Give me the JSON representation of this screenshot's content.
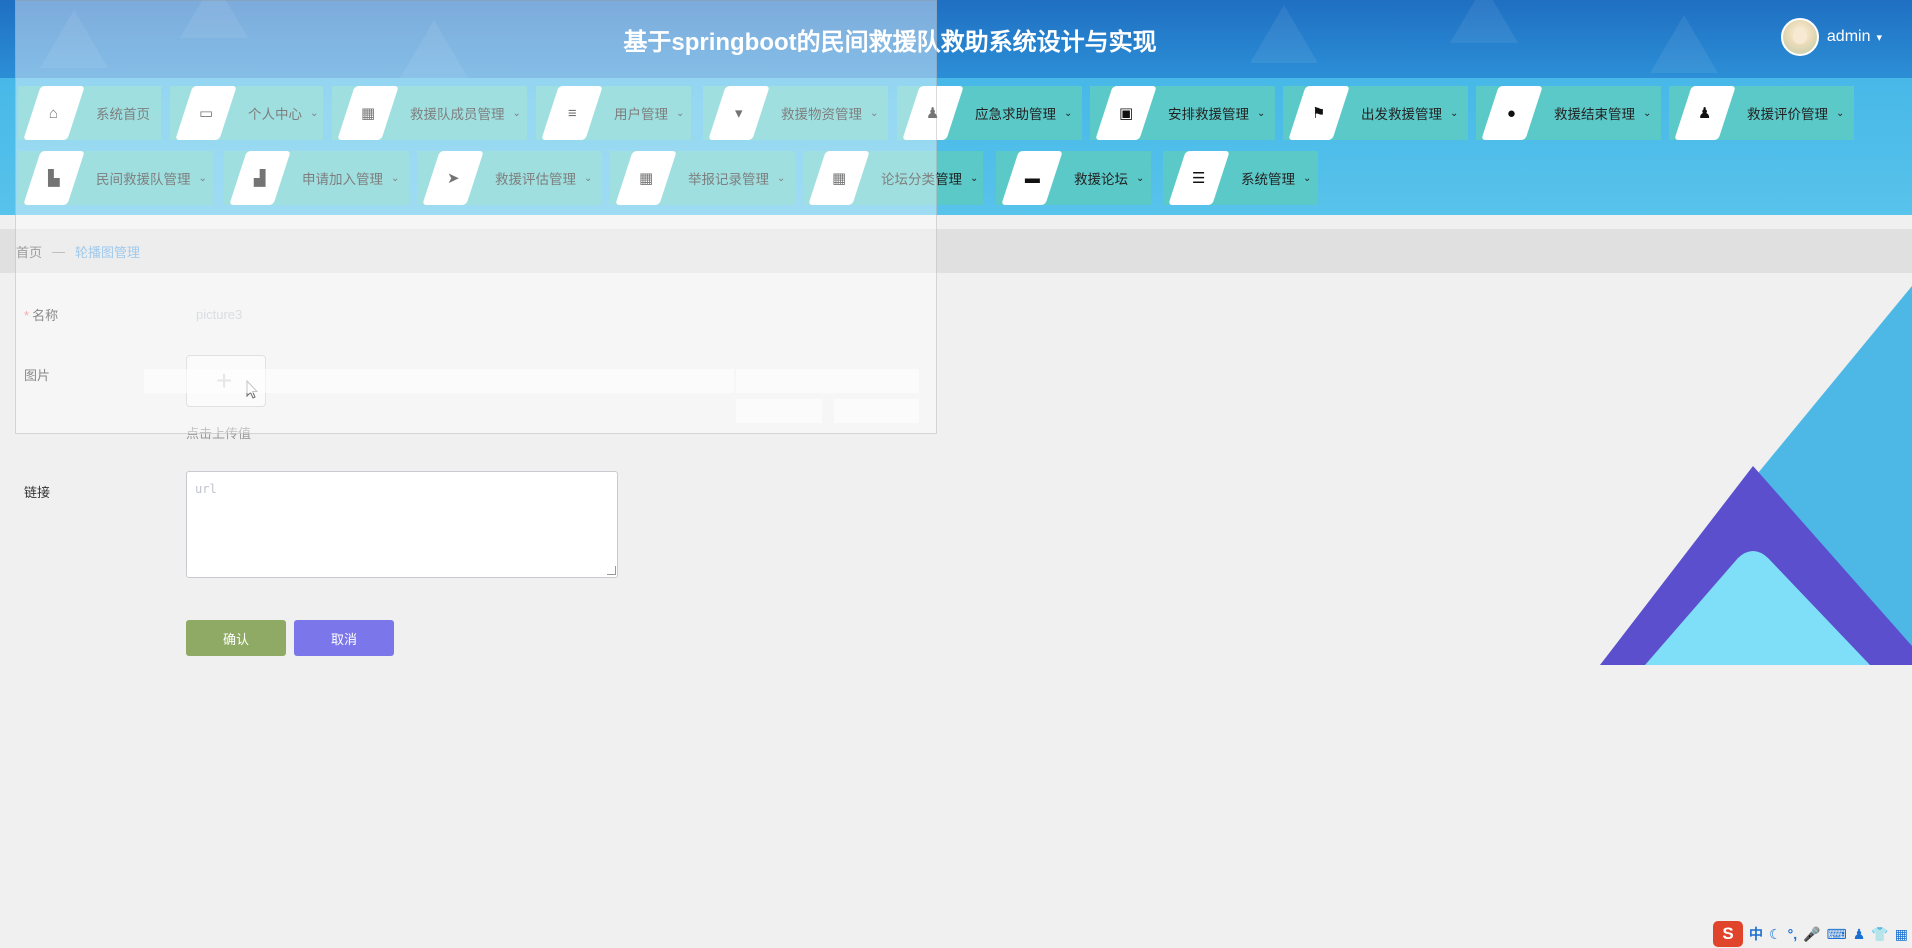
{
  "header": {
    "title": "基于springboot的民间救援队救助系统设计与实现",
    "user_name": "admin",
    "user_caret": "▾"
  },
  "nav": {
    "row1": [
      {
        "label": "系统首页",
        "icon": "home-icon",
        "glyph": "⌂",
        "has_submenu": false
      },
      {
        "label": "个人中心",
        "icon": "card-icon",
        "glyph": "▭",
        "has_submenu": true
      },
      {
        "label": "救援队成员管理",
        "icon": "grid-icon",
        "glyph": "▦",
        "has_submenu": true
      },
      {
        "label": "用户管理",
        "icon": "sliders-icon",
        "glyph": "≡",
        "has_submenu": true
      },
      {
        "label": "救援物资管理",
        "icon": "brush-icon",
        "glyph": "▾",
        "has_submenu": true
      },
      {
        "label": "应急求助管理",
        "icon": "person-icon",
        "glyph": "♟",
        "has_submenu": true
      },
      {
        "label": "安排救援管理",
        "icon": "clipboard-icon",
        "glyph": "▣",
        "has_submenu": true
      },
      {
        "label": "出发救援管理",
        "icon": "flag-icon",
        "glyph": "⚑",
        "has_submenu": true
      },
      {
        "label": "救援结束管理",
        "icon": "location-icon",
        "glyph": "●",
        "has_submenu": true
      },
      {
        "label": "救援评价管理",
        "icon": "user-icon",
        "glyph": "♟",
        "has_submenu": true
      }
    ],
    "row2": [
      {
        "label": "民间救援队管理",
        "icon": "building-icon",
        "glyph": "▙",
        "has_submenu": true
      },
      {
        "label": "申请加入管理",
        "icon": "mailbox-icon",
        "glyph": "▟",
        "has_submenu": true
      },
      {
        "label": "救援评估管理",
        "icon": "send-icon",
        "glyph": "➤",
        "has_submenu": true
      },
      {
        "label": "举报记录管理",
        "icon": "grid-icon",
        "glyph": "▦",
        "has_submenu": true
      },
      {
        "label": "论坛分类管理",
        "icon": "grid-icon",
        "glyph": "▦",
        "has_submenu": true
      },
      {
        "label": "救援论坛",
        "icon": "chat-icon",
        "glyph": "▬",
        "has_submenu": true
      },
      {
        "label": "系统管理",
        "icon": "menu-icon",
        "glyph": "☰",
        "has_submenu": true
      }
    ],
    "caret": "⌄"
  },
  "breadcrumb": {
    "home": "首页",
    "separator": "—",
    "current": "轮播图管理"
  },
  "form": {
    "name_label": "名称",
    "required_mark": "*",
    "name_placeholder": "picture3",
    "image_label": "图片",
    "upload_plus": "+",
    "upload_tip": "点击上传值",
    "link_label": "链接",
    "link_placeholder": "url",
    "confirm_label": "确认",
    "cancel_label": "取消"
  },
  "tray": {
    "logo": "S",
    "ime": "中",
    "items": [
      "☾",
      "°,",
      "🎤",
      "⌨",
      "♟",
      "👕",
      "▦"
    ]
  },
  "colors": {
    "header_bg": "#1f6fc2",
    "nav_bg": "#4fbde9",
    "nav_item_bg": "#5cc9c9",
    "confirm_bg": "#8faa64",
    "cancel_bg": "#7b77ea",
    "crumb_active": "#5ba3e0",
    "deco_light_blue": "#4db8e6",
    "deco_purple": "#5b4fce",
    "deco_cyan": "#7fdff8"
  }
}
